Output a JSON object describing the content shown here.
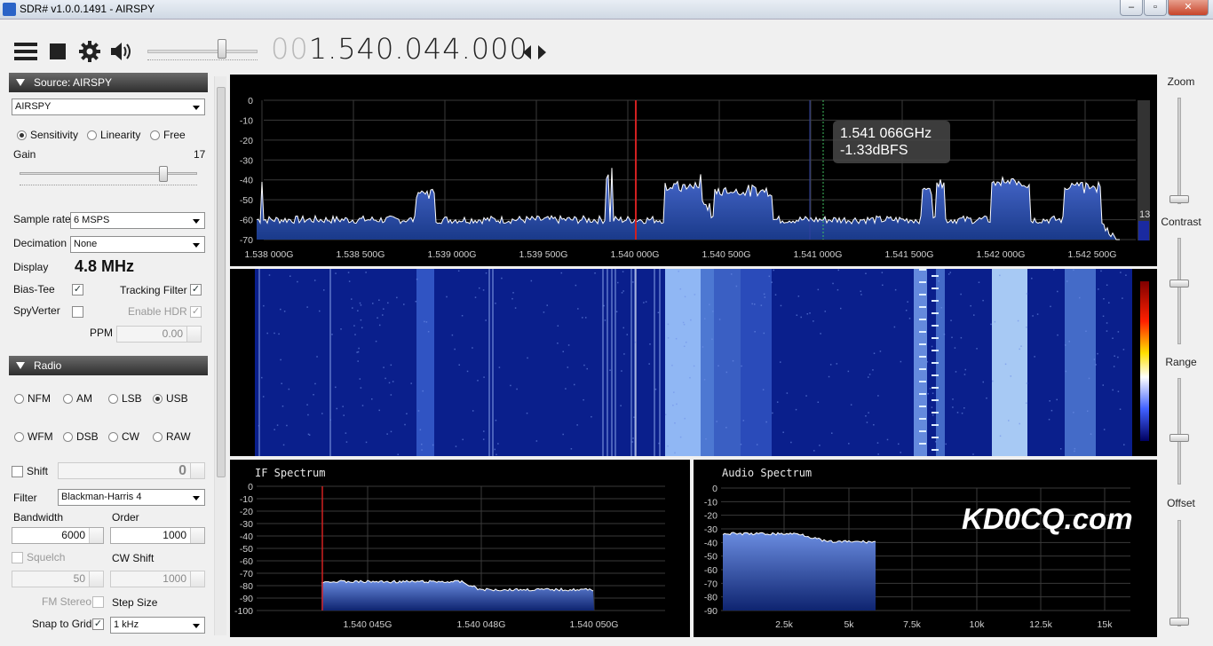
{
  "window": {
    "title": "SDR# v1.0.0.1491 - AIRSPY",
    "min": "‒",
    "max": "▫",
    "close": "✕"
  },
  "toolbar": {
    "freq_dim": "00",
    "freq_main": "1.540.044.000",
    "icons": [
      "menu-icon",
      "stop-icon",
      "gear-icon",
      "speaker-icon",
      "tune-arrows-icon"
    ],
    "volume": 0.68
  },
  "source": {
    "header": "Source: AIRSPY",
    "device": "AIRSPY",
    "modes": [
      {
        "label": "Sensitivity",
        "selected": true
      },
      {
        "label": "Linearity",
        "selected": false
      },
      {
        "label": "Free",
        "selected": false
      }
    ],
    "gain_label": "Gain",
    "gain_value": "17",
    "gain_level": 17,
    "sample_rate_label": "Sample rate",
    "sample_rate": "6 MSPS",
    "decimation_label": "Decimation",
    "decimation": "None",
    "display_label": "Display",
    "display_value": "4.8 MHz",
    "bias_tee": "Bias-Tee",
    "tracking_filter": "Tracking Filter",
    "spyverter": "SpyVerter",
    "enable_hdr": "Enable HDR",
    "ppm_label": "PPM",
    "ppm": "0.00"
  },
  "radio": {
    "header": "Radio",
    "modes": [
      {
        "label": "NFM",
        "selected": false
      },
      {
        "label": "AM",
        "selected": false
      },
      {
        "label": "LSB",
        "selected": false
      },
      {
        "label": "USB",
        "selected": true
      },
      {
        "label": "WFM",
        "selected": false
      },
      {
        "label": "DSB",
        "selected": false
      },
      {
        "label": "CW",
        "selected": false
      },
      {
        "label": "RAW",
        "selected": false
      }
    ],
    "shift_label": "Shift",
    "shift_value": "0",
    "filter_label": "Filter",
    "filter": "Blackman-Harris 4",
    "bandwidth_label": "Bandwidth",
    "bandwidth": "6000",
    "order_label": "Order",
    "order": "1000",
    "squelch_label": "Squelch",
    "squelch": "50",
    "cw_shift_label": "CW Shift",
    "cw_shift": "1000",
    "fm_stereo": "FM Stereo",
    "step_size_label": "Step Size",
    "snap_label": "Snap to Grid",
    "snap": "1 kHz"
  },
  "main_spectrum": {
    "y_ticks": [
      "0",
      "-10",
      "-20",
      "-30",
      "-40",
      "-50",
      "-60",
      "-70"
    ],
    "x_ticks": [
      "1.538 000G",
      "1.538 500G",
      "1.539 000G",
      "1.539 500G",
      "1.540 000G",
      "1.540 500G",
      "1.541 000G",
      "1.541 500G",
      "1.542 000G",
      "1.542 500G"
    ],
    "tooltip_freq": "1.541 066GHz",
    "tooltip_level": "-1.33dBFS",
    "side_value": "13"
  },
  "if_spectrum": {
    "title": "IF Spectrum",
    "y_ticks": [
      "0",
      "-10",
      "-20",
      "-30",
      "-40",
      "-50",
      "-60",
      "-70",
      "-80",
      "-90",
      "-100"
    ],
    "x_ticks": [
      "1.540 045G",
      "1.540 048G",
      "1.540 050G"
    ]
  },
  "audio_spectrum": {
    "title": "Audio Spectrum",
    "y_ticks": [
      "0",
      "-10",
      "-20",
      "-30",
      "-40",
      "-50",
      "-60",
      "-70",
      "-80",
      "-90"
    ],
    "x_ticks": [
      "2.5k",
      "5k",
      "7.5k",
      "10k",
      "12.5k",
      "15k"
    ],
    "watermark": "KD0CQ.com"
  },
  "right_sliders": {
    "zoom": "Zoom",
    "contrast": "Contrast",
    "range": "Range",
    "offset": "Offset"
  },
  "colors": {
    "spectrum_fill": "#1a3a8a",
    "waterfall_bg": "#0a1f8c",
    "accent_red": "#d02020"
  }
}
